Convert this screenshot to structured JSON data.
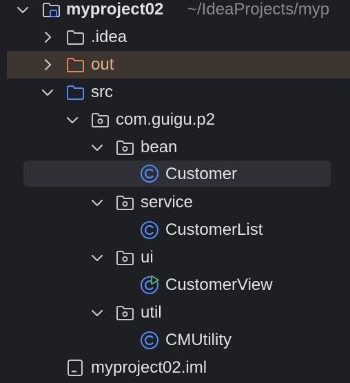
{
  "project": {
    "name": "myproject02",
    "path": "~/IdeaProjects/myp"
  },
  "nodes": {
    "idea": "idea",
    "out": "out",
    "src": "src",
    "package": "com.guigu.p2",
    "bean": "bean",
    "customer": "Customer",
    "service": "service",
    "customer_list": "CustomerList",
    "ui": "ui",
    "customer_view": "CustomerView",
    "util": "util",
    "cm_utility": "CMUtility",
    "iml": "myproject02.iml"
  },
  "icons": {
    "folder": "folder-icon",
    "excluded_folder": "excluded-folder-icon",
    "source_folder": "source-folder-icon",
    "package": "package-icon",
    "class": "class-icon",
    "runnable_class": "runnable-class-icon",
    "module_file": "module-file-icon"
  },
  "colors": {
    "background": "#1e1f22",
    "text": "#dfe1e5",
    "path_text": "#868a91",
    "excluded_row": "#3d3630",
    "excluded_text": "#e0b38f",
    "selection": "#2e3035",
    "source_blue": "#548af7",
    "run_green": "#5fb865"
  }
}
